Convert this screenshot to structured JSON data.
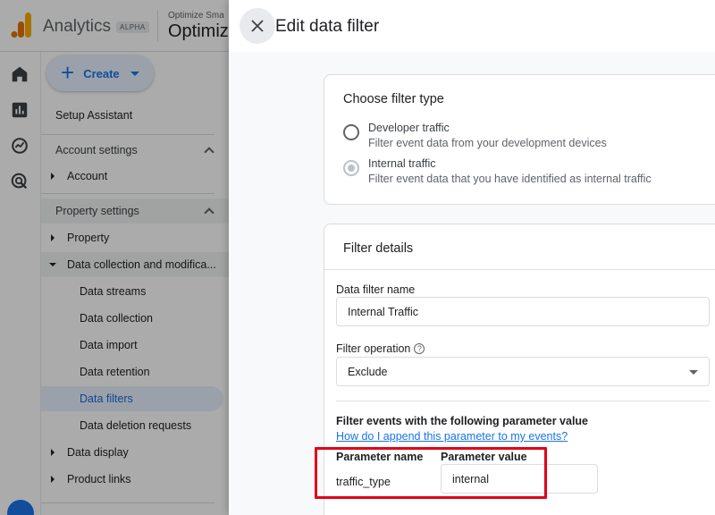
{
  "colors": {
    "accent": "#1a73e8",
    "highlight_border": "#e0001b",
    "selected_nav_bg": "#e8f0fe"
  },
  "app": {
    "name": "Analytics",
    "badge": "ALPHA",
    "account_small": "Optimize Sma",
    "account_big": "Optimiz"
  },
  "rail_icons": [
    "home-icon",
    "reports-icon",
    "explore-icon",
    "advertising-icon",
    "settings-icon"
  ],
  "nav": {
    "create_label": "Create",
    "setup_assistant": "Setup Assistant",
    "account_settings": "Account settings",
    "account": "Account",
    "property_settings": "Property settings",
    "property": "Property",
    "data_collection": "Data collection and modifica...",
    "sub_items": [
      "Data streams",
      "Data collection",
      "Data import",
      "Data retention",
      "Data filters",
      "Data deletion requests"
    ],
    "data_display": "Data display",
    "product_links": "Product links"
  },
  "panel": {
    "title": "Edit data filter",
    "filter_type": {
      "heading": "Choose filter type",
      "options": [
        {
          "title": "Developer traffic",
          "desc": "Filter event data from your development devices",
          "selected": false
        },
        {
          "title": "Internal traffic",
          "desc": "Filter event data that you have identified as internal traffic",
          "selected": true
        }
      ]
    },
    "details": {
      "heading": "Filter details",
      "name_label": "Data filter name",
      "name_value": "Internal Traffic",
      "operation_label": "Filter operation",
      "operation_value": "Exclude",
      "param_heading": "Filter events with the following parameter value",
      "help_link": "How do I append this parameter to my events?",
      "param_name_label": "Parameter name",
      "param_name_value": "traffic_type",
      "param_value_label": "Parameter value",
      "param_value_value": "internal"
    }
  }
}
